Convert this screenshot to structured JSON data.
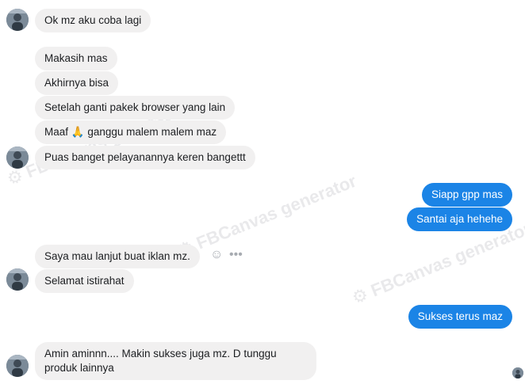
{
  "watermark": {
    "text": "FBCanvas generator"
  },
  "messages": [
    {
      "text": "Ok mz aku coba lagi"
    },
    {
      "text": "Makasih mas"
    },
    {
      "text": "Akhirnya bisa"
    },
    {
      "text": "Setelah ganti pakek browser yang lain"
    },
    {
      "text_before": "Maaf",
      "emoji": "🙏",
      "text_after": "ganggu malem malem maz"
    },
    {
      "text": "Puas banget pelayanannya keren bangettt"
    },
    {
      "text": "Siapp gpp mas"
    },
    {
      "text": "Santai aja hehehe"
    },
    {
      "text": "Saya mau lanjut buat iklan mz."
    },
    {
      "text": "Selamat istirahat"
    },
    {
      "text": "Sukses terus maz"
    },
    {
      "text": "Amin aminnn.... Makin sukses juga mz. D tunggu produk lainnya"
    }
  ],
  "icons": {
    "react": "smiley-icon",
    "more": "more-dots-icon",
    "avatar": "user-avatar",
    "seen": "seen-avatar"
  },
  "colors": {
    "incoming_bubble": "#f1f0f0",
    "outgoing_bubble": "#1b84e6",
    "watermark": "#d8d8dc"
  }
}
